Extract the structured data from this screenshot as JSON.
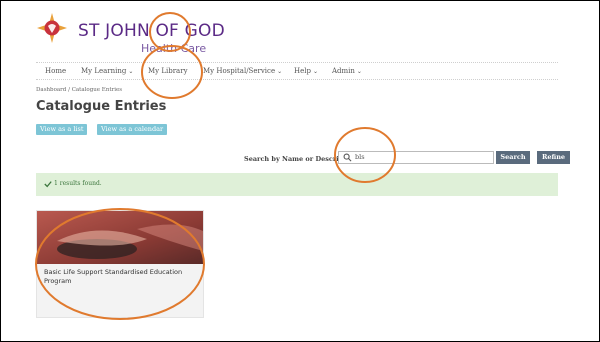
{
  "brand": {
    "title": "ST JOHN OF GOD",
    "subtitle": "Health Care",
    "icon": "cross-logo-icon",
    "colors": {
      "primary": "#5b2a86",
      "accent": "#e9a13b",
      "logo_red": "#c8323c"
    }
  },
  "nav": {
    "items": [
      {
        "label": "Home",
        "has_dropdown": false
      },
      {
        "label": "My Learning",
        "has_dropdown": true
      },
      {
        "label": "My Library",
        "has_dropdown": false
      },
      {
        "label": "My Hospital/Service",
        "has_dropdown": true
      },
      {
        "label": "Help",
        "has_dropdown": true
      },
      {
        "label": "Admin",
        "has_dropdown": true
      }
    ],
    "dropdown_glyph": "⌄"
  },
  "breadcrumb": {
    "home": "Dashboard",
    "separator": "/",
    "current": "Catalogue Entries"
  },
  "page": {
    "title": "Catalogue Entries",
    "view_list_label": "View as a list",
    "view_calendar_label": "View as a calendar"
  },
  "search": {
    "label": "Search by Name or Description",
    "value": "bls",
    "search_label": "Search",
    "refine_label": "Refine"
  },
  "results": {
    "message": "1 results found."
  },
  "catalogue": {
    "items": [
      {
        "title": "Basic Life Support Standardised Education Program"
      }
    ]
  },
  "annotation_color": "#e07a2e"
}
